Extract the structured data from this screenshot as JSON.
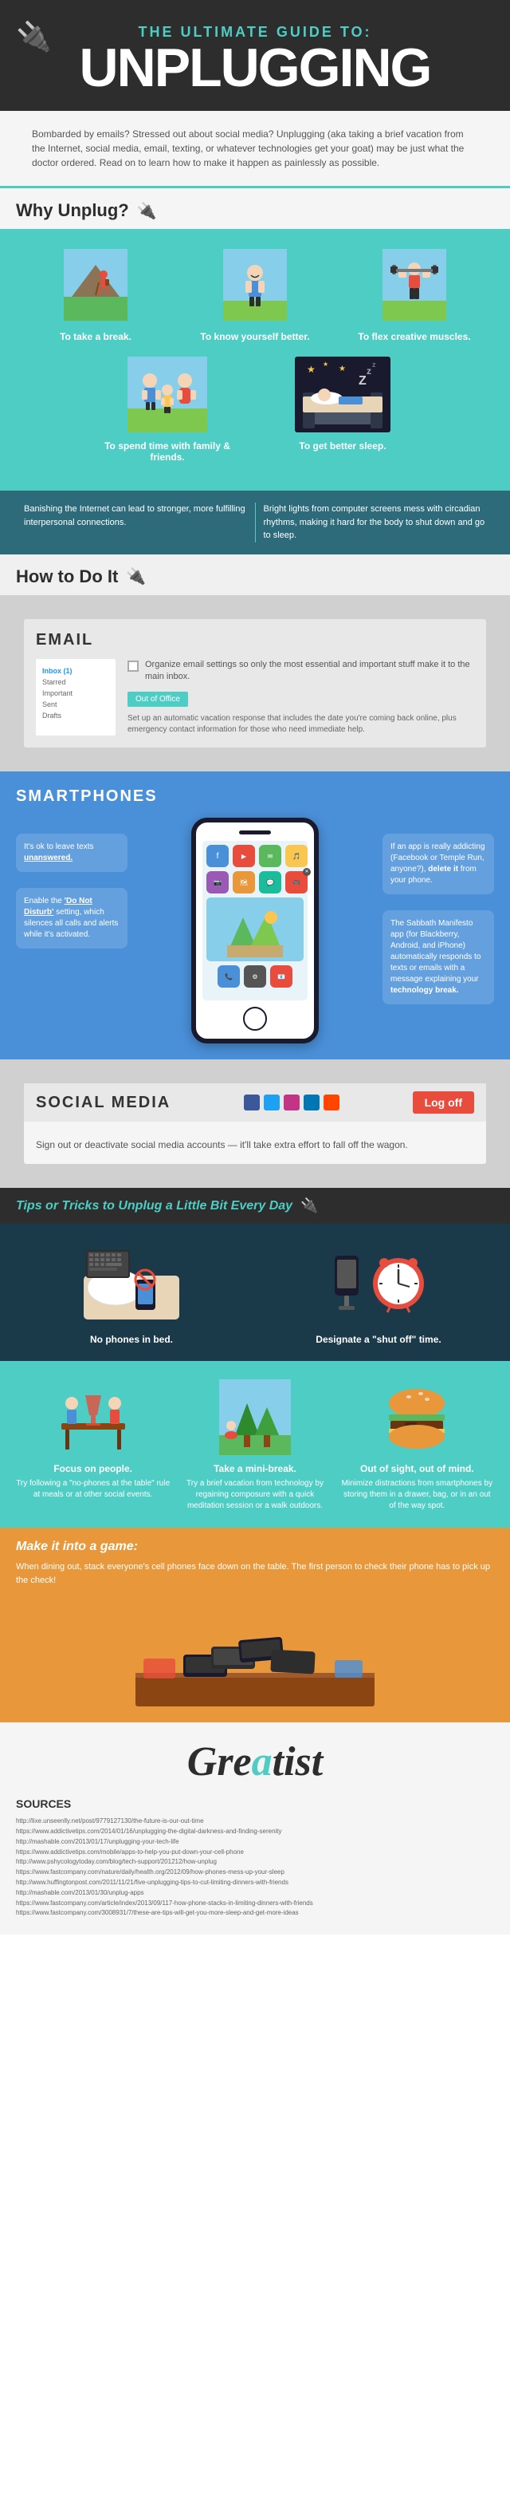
{
  "header": {
    "subtitle": "THE ULTIMATE GUIDE TO:",
    "title": "UNPLUGGING",
    "plug_icon": "🔌"
  },
  "intro": {
    "text": "Bombarded by emails? Stressed out about social media? Unplugging (aka taking a brief vacation from the Internet, social media, email, texting, or whatever technologies get your goat) may be just what the doctor ordered. Read on to learn how to make it happen as painlessly as possible."
  },
  "why_section": {
    "title": "Why Unplug?",
    "reasons": [
      {
        "label": "To take a break.",
        "icon": "hiker"
      },
      {
        "label": "To know yourself better.",
        "icon": "person"
      },
      {
        "label": "To flex creative muscles.",
        "icon": "dumbbell"
      }
    ],
    "reasons_bottom": [
      {
        "label": "To spend time with family & friends.",
        "icon": "family"
      },
      {
        "label": "To get better sleep.",
        "icon": "sleep"
      }
    ],
    "descriptions": [
      {
        "text": "Banishing the Internet can lead to stronger, more fulfilling interpersonal connections."
      },
      {
        "text": "Bright lights from computer screens mess with circadian rhythms, making it hard for the body to shut down and go to sleep."
      }
    ]
  },
  "how_section": {
    "title": "How to Do It",
    "plug_icon": "🔌"
  },
  "email_section": {
    "title": "EMAIL",
    "sidebar_items": [
      "Inbox (1)",
      "Starred",
      "Important",
      "Sent",
      "Drafts"
    ],
    "checkbox_text": "Organize email settings so only the most essential and important stuff make it to the main inbox.",
    "out_of_office_btn": "Out of Office",
    "out_of_office_text": "Set up an automatic vacation response that includes the date you're coming back online, plus emergency contact information for those who need immediate help."
  },
  "smartphones_section": {
    "title": "SMARTPHONES",
    "tips": [
      {
        "text": "It's ok to leave texts unanswered.",
        "position": "left"
      },
      {
        "text": "Enable the 'Do Not Disturb' setting, which silences all calls and alerts while it's activated.",
        "position": "left"
      },
      {
        "text": "If an app is really addicting (Facebook or Temple Run, anyone?), delete it from your phone.",
        "position": "right"
      },
      {
        "text": "The Sabbath Manifesto app (for Blackberry, Android, and iPhone) automatically responds to texts or emails with a message explaining your technology break.",
        "position": "right"
      }
    ]
  },
  "social_section": {
    "title": "SOCIAL MEDIA",
    "log_off_label": "Log off",
    "description": "Sign out or deactivate social media accounts — it'll take extra effort to fall off the wagon."
  },
  "tips_section": {
    "title": "Tips or Tricks to Unplug a Little Bit Every Day",
    "plug_icon": "🔌",
    "daily_tips": [
      {
        "label": "No phones in bed.",
        "icon": "keyboard",
        "desc": ""
      },
      {
        "label": "Designate a \"shut off\" time.",
        "icon": "alarm",
        "desc": ""
      }
    ],
    "more_tips": [
      {
        "label": "Focus on people.",
        "icon": "wine",
        "desc": "Try following a \"no-phones at the table\" rule at meals or at other social events."
      },
      {
        "label": "Take a mini-break.",
        "icon": "trees",
        "desc": "Try a brief vacation from technology by regaining composure with a quick meditation session or a walk outdoors."
      },
      {
        "label": "Out of sight, out of mind.",
        "icon": "burger",
        "desc": "Minimize distractions from smartphones by storing them in a drawer, bag, or in an out of the way spot."
      }
    ]
  },
  "game_section": {
    "title": "Make it into a game:",
    "text": "When dining out, stack everyone's cell phones face down on the table. The first person to check their phone has to pick up the check!"
  },
  "footer": {
    "logo_text": "Greatist",
    "logo_accent": "a",
    "sources_title": "SOURCES",
    "sources": [
      "http://lixe.unseenlly.net/post/9779127130/the-future-is-our-out-time",
      "https://www.addictivetips.com/2014/01/16/unplugging-the-digital-darkness-and-finding-serenity",
      "http://mashable.com/2013/01/17/unplugging-your-tech-life",
      "https://www.addictivetips.com/mobile/apps-to-help-you-put-down-your-cell-phone",
      "http://www.pshycologytoday.com/blog/tech-support/201212/how-unplug",
      "https://www.fastcompany.com/nature/daily/health.org/2012/09/how-phones-mess-up-your-sleep",
      "http://www.huffingtonpost.com/2011/11/21/five-unplugging-tips-to-cut-limiting-dinners-with-friends",
      "http://mashable.com/2013/01/30/unplug-apps",
      "https://www.fastcompany.com/article/index/2013/09/117-how-phone-stacks-in-limiting-dinners-with-friends",
      "https://www.fastcompany.com/3008931/7/these-are-tips-will-get-you-more-sleep-and-get-more-ideas"
    ]
  }
}
